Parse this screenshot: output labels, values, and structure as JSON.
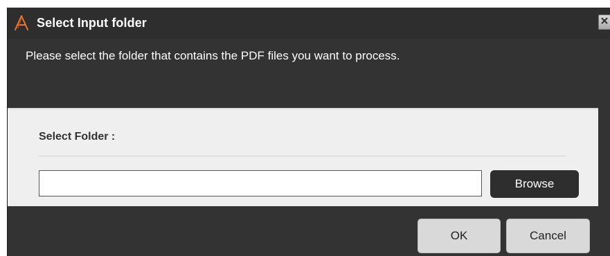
{
  "dialog": {
    "title": "Select Input folder",
    "instruction": "Please select the folder that contains the PDF files you want to process."
  },
  "panel": {
    "label": "Select Folder :",
    "input_value": "",
    "browse_label": "Browse"
  },
  "footer": {
    "ok_label": "OK",
    "cancel_label": "Cancel"
  },
  "icons": {
    "app": "app-logo-icon",
    "close": "close-icon"
  },
  "colors": {
    "dialog_bg": "#333333",
    "panel_bg": "#efefef",
    "browse_bg": "#2e2e2e",
    "button_bg": "#d9d9d9"
  }
}
